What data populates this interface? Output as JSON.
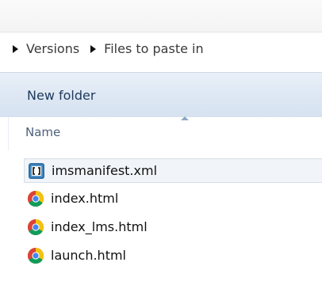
{
  "breadcrumb": {
    "items": [
      {
        "label": "Versions"
      },
      {
        "label": "Files to paste in"
      }
    ]
  },
  "toolbar": {
    "new_folder_label": "New folder"
  },
  "columns": {
    "name_label": "Name"
  },
  "files": [
    {
      "name": "imsmanifest.xml",
      "icon": "xml-file-icon",
      "selected": true
    },
    {
      "name": "index.html",
      "icon": "chrome-icon",
      "selected": false
    },
    {
      "name": "index_lms.html",
      "icon": "chrome-icon",
      "selected": false
    },
    {
      "name": "launch.html",
      "icon": "chrome-icon",
      "selected": false
    }
  ],
  "colors": {
    "toolbar_bg": "#dde7f3",
    "header_text": "#4c607a",
    "accent": "#1e395b"
  }
}
